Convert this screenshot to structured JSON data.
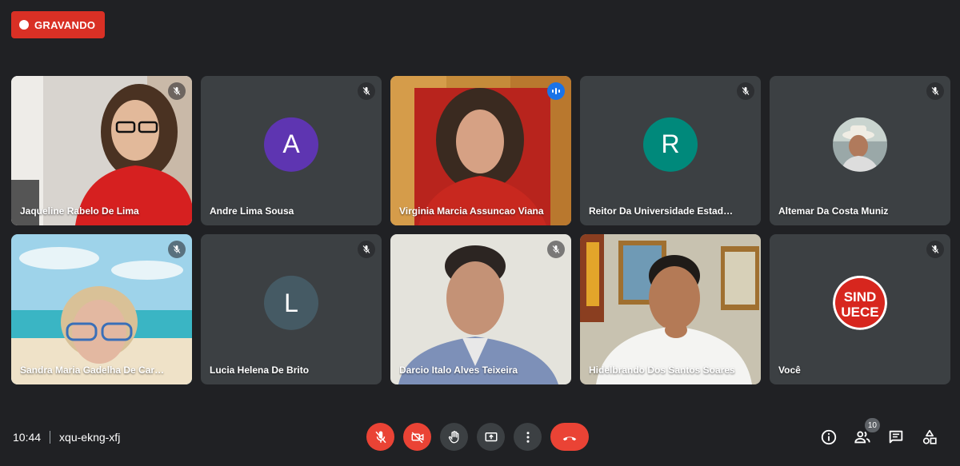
{
  "recording": {
    "label": "GRAVANDO"
  },
  "participants": [
    {
      "name": "Jaqueline Rabelo De Lima",
      "type": "video",
      "muted": true
    },
    {
      "name": "Andre Lima Sousa",
      "type": "avatar",
      "letter": "A",
      "color": "#5e35b1",
      "muted": true
    },
    {
      "name": "Virginia Marcia Assuncao Viana",
      "type": "video",
      "speaking": true
    },
    {
      "name": "Reitor Da Universidade Estadual ...",
      "type": "avatar",
      "letter": "R",
      "color": "#00897b",
      "muted": true
    },
    {
      "name": "Altemar Da Costa Muniz",
      "type": "photo-avatar",
      "muted": true
    },
    {
      "name": "Sandra Maria Gadelha De Carval...",
      "type": "video",
      "muted": true
    },
    {
      "name": "Lucia Helena De Brito",
      "type": "avatar",
      "letter": "L",
      "color": "#455a64",
      "muted": true
    },
    {
      "name": "Darcio Italo Alves Teixeira",
      "type": "video",
      "muted": true
    },
    {
      "name": "Hidelbrando Dos Santos Soares",
      "type": "video",
      "muted": false
    },
    {
      "name": "Você",
      "type": "logo-avatar",
      "logo_text_1": "SIND",
      "logo_text_2": "UECE",
      "muted": true
    }
  ],
  "meeting": {
    "time": "10:44",
    "code": "xqu-ekng-xfj"
  },
  "controls": {
    "mic": "mic-off-icon",
    "camera": "camera-off-icon",
    "hand": "raise-hand-icon",
    "present": "present-screen-icon",
    "more": "more-options-icon",
    "leave": "hang-up-icon"
  },
  "people_count": "10",
  "colors": {
    "background": "#202124",
    "tile": "#3c4043",
    "red": "#ea4335",
    "speaking": "#8ab4f8"
  }
}
